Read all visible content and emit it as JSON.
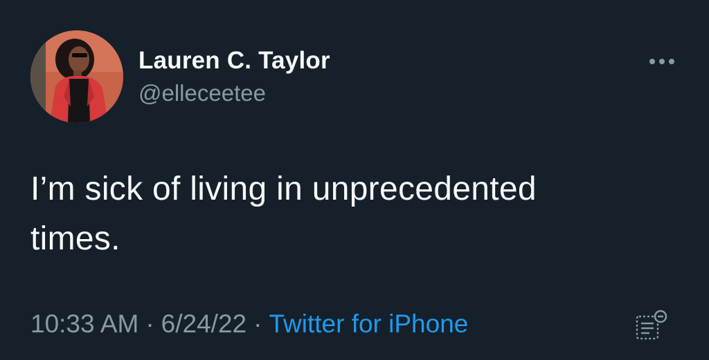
{
  "tweet": {
    "author": {
      "display_name": "Lauren C. Taylor",
      "handle": "@elleceetee"
    },
    "text_line1": "I’m sick of living in unprecedented",
    "text_line2": "times.",
    "time": "10:33 AM",
    "separator": "·",
    "date": "6/24/22",
    "source": "Twitter for iPhone"
  },
  "icons": {
    "more": "more-horizontal-icon",
    "analytics": "tweet-analytics-icon"
  },
  "colors": {
    "background": "#15202b",
    "primary_text": "#f7f9f9",
    "secondary_text": "#8b98a5",
    "link": "#1d9bf0"
  }
}
